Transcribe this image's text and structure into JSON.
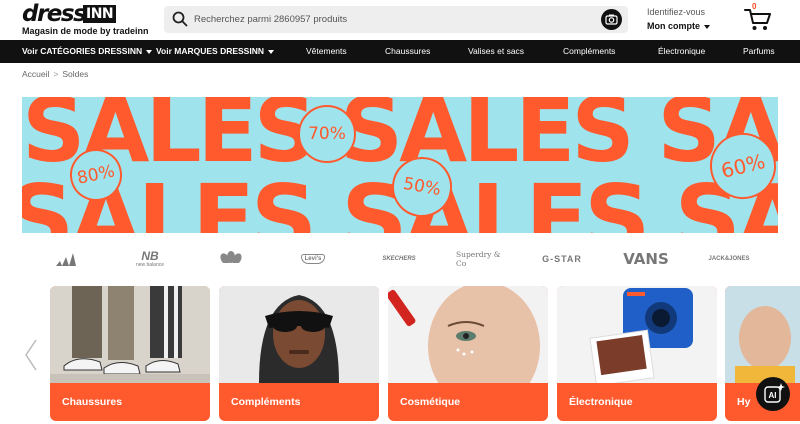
{
  "header": {
    "logo_word": "dress",
    "logo_box": "INN",
    "logo_sub": "Magasin de mode by tradeinn",
    "search_placeholder": "Recherchez parmi 2860957 produits",
    "account_top": "Identifiez-vous",
    "account_main": "Mon compte",
    "cart_count": "0"
  },
  "nav": {
    "categories": "Voir CATÉGORIES DRESSINN",
    "brands": "Voir MARQUES DRESSINN",
    "items": [
      "Vêtements",
      "Chaussures",
      "Valises et sacs",
      "Compléments",
      "Électronique",
      "Parfums"
    ]
  },
  "breadcrumb": [
    "Accueil",
    "Soldes"
  ],
  "banner": {
    "word": "SALES",
    "badges": [
      "80%",
      "70%",
      "50%",
      "60%"
    ],
    "colors": {
      "background": "#9fe4ec",
      "text": "#ff5a2e"
    }
  },
  "brands": [
    "adidas",
    "new balance",
    "adidas originals",
    "Levi's",
    "SKECHERS",
    "Superdry & Co",
    "G-STAR",
    "VANS",
    "JACK&JONES"
  ],
  "categories": [
    {
      "label": "Chaussures",
      "image": "sneakers-photo"
    },
    {
      "label": "Compléments",
      "image": "sunglasses-photo"
    },
    {
      "label": "Cosmétique",
      "image": "skincare-photo"
    },
    {
      "label": "Électronique",
      "image": "instant-camera-photo"
    },
    {
      "label": "Hy",
      "image": "person-photo"
    }
  ],
  "colors": {
    "accent": "#ff5a2e",
    "nav_bg": "#111111"
  }
}
